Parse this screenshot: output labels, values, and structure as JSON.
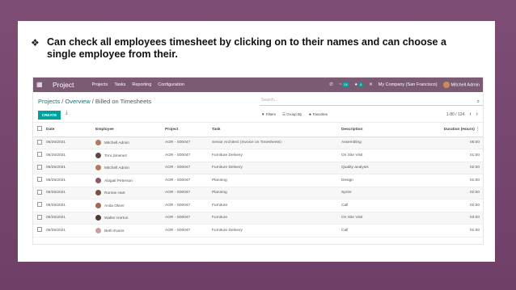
{
  "slide": {
    "bullet_text": "Can check all employees timesheet by clicking on to their names and can choose a single employee from their."
  },
  "navbar": {
    "app_title": "Project",
    "menus": [
      "Projects",
      "Tasks",
      "Reporting",
      "Configuration"
    ],
    "chat_badge": "24",
    "activity_badge": "4",
    "company": "My Company (San Francisco)",
    "user": "Mitchell Admin"
  },
  "breadcrumb": {
    "item1": "Projects",
    "item2": "Overview",
    "current": "Billed on Timesheets"
  },
  "search": {
    "placeholder": "Search..."
  },
  "toolbar": {
    "create_label": "CREATE",
    "filters_label": "Filters",
    "groupby_label": "Group By",
    "favorites_label": "Favorites",
    "pager": "1-80 / 124"
  },
  "table": {
    "headers": {
      "date": "Date",
      "employee": "Employee",
      "project": "Project",
      "task": "Task",
      "description": "Description",
      "duration": "Duration (Hours)"
    },
    "rows": [
      {
        "date": "06/26/2021",
        "employee": "Mitchell Admin",
        "avatar_color": "#b07a5c",
        "project": "AGR - S00047",
        "task": "Senior Architect (Invoice on Timesheets)",
        "description": "Assembling",
        "duration": "05:00"
      },
      {
        "date": "06/25/2021",
        "employee": "Toni Jimenez",
        "avatar_color": "#5a4a44",
        "project": "AGR - S00047",
        "task": "Furniture Delivery",
        "description": "On Site Visit",
        "duration": "01:00"
      },
      {
        "date": "06/25/2021",
        "employee": "Mitchell Admin",
        "avatar_color": "#b07a5c",
        "project": "AGR - S00047",
        "task": "Furniture Delivery",
        "description": "Quality analysis",
        "duration": "02:00"
      },
      {
        "date": "06/25/2021",
        "employee": "Abigail Peterson",
        "avatar_color": "#8a5a6a",
        "project": "AGR - S00047",
        "task": "Planning",
        "description": "Design",
        "duration": "01:00"
      },
      {
        "date": "06/25/2021",
        "employee": "Ronnie Hart",
        "avatar_color": "#7a5040",
        "project": "AGR - S00047",
        "task": "Planning",
        "description": "Sprint",
        "duration": "02:00"
      },
      {
        "date": "06/25/2021",
        "employee": "Anita Oliver",
        "avatar_color": "#a06a50",
        "project": "AGR - S00047",
        "task": "Furniture",
        "description": "Call",
        "duration": "02:00"
      },
      {
        "date": "06/25/2021",
        "employee": "Walter Horton",
        "avatar_color": "#4a3a30",
        "project": "AGR - S00047",
        "task": "Furniture",
        "description": "On Site Visit",
        "duration": "03:00"
      },
      {
        "date": "06/25/2021",
        "employee": "Beth Evans",
        "avatar_color": "#c9a0a0",
        "project": "AGR - S00047",
        "task": "Furniture Delivery",
        "description": "Call",
        "duration": "01:00"
      }
    ]
  },
  "colors": {
    "navbar": "#7b5a73",
    "accent": "#00a09d",
    "slide_bg": "#7a4a72"
  }
}
